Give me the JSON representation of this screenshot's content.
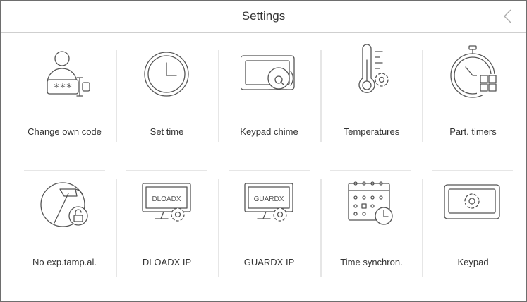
{
  "header": {
    "title": "Settings",
    "back_icon": "chevron-left-icon"
  },
  "colors": {
    "icon_stroke": "#555555",
    "separator": "#e6e6e6",
    "border": "#6e6e6e"
  },
  "tiles": [
    {
      "label": "Change own code",
      "icon": "user-password-icon"
    },
    {
      "label": "Set time",
      "icon": "clock-icon"
    },
    {
      "label": "Keypad chime",
      "icon": "keypad-bell-icon"
    },
    {
      "label": "Temperatures",
      "icon": "thermometer-gear-icon"
    },
    {
      "label": "Part. timers",
      "icon": "stopwatch-grid-icon"
    },
    {
      "label": "No exp.tamp.al.",
      "icon": "hammer-unlock-icon"
    },
    {
      "label": "DLOADX IP",
      "icon": "monitor-gear-icon"
    },
    {
      "label": "GUARDX IP",
      "icon": "monitor-gear-icon"
    },
    {
      "label": "Time synchron.",
      "icon": "calendar-clock-icon"
    },
    {
      "label": "Keypad",
      "icon": "keypad-gear-icon"
    }
  ],
  "screen_texts": {
    "dloadx": "DLOADX",
    "guardx": "GUARDX",
    "password_mask": "***"
  }
}
